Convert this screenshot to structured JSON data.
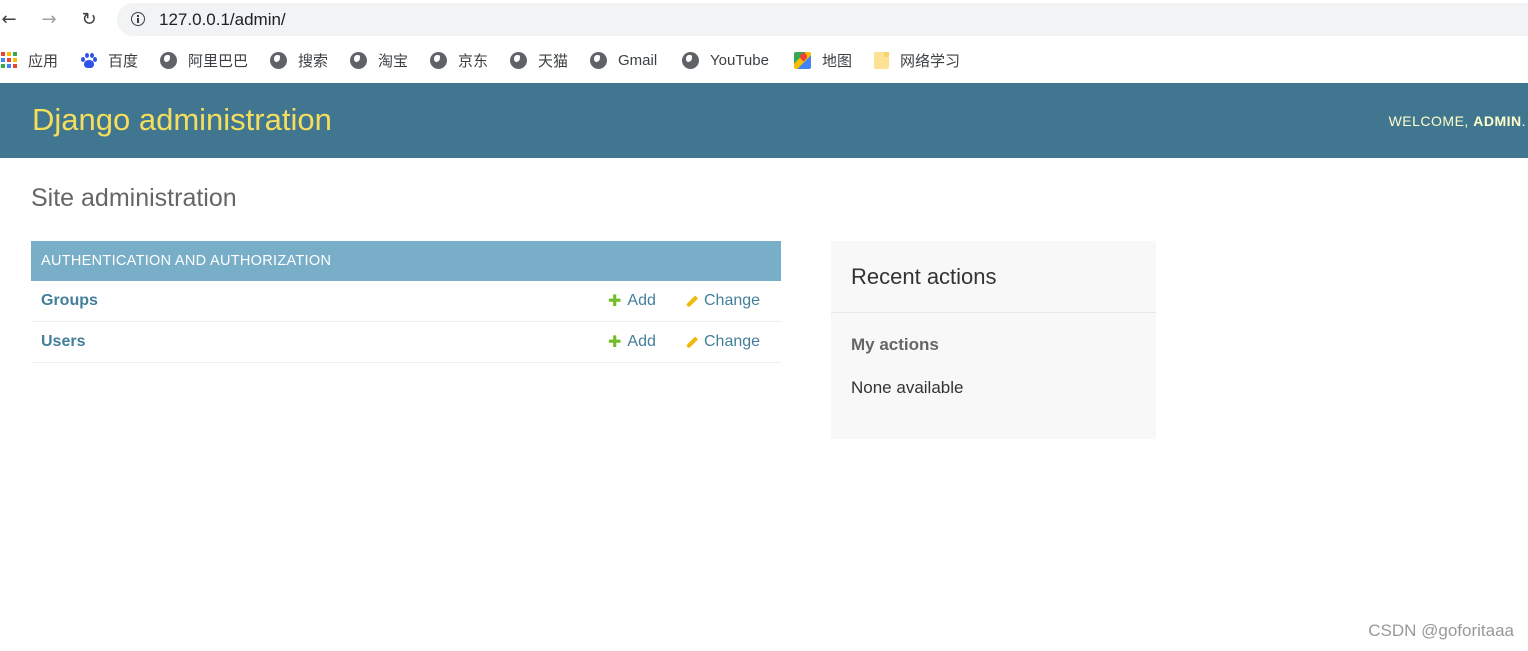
{
  "browser": {
    "nav": {
      "back_glyph": "←",
      "forward_glyph": "→",
      "reload_glyph": "↻"
    },
    "url": "127.0.0.1/admin/",
    "bookmarks": [
      {
        "label": "应用",
        "icon": "apps-grid-icon"
      },
      {
        "label": "百度",
        "icon": "baidu-paw-icon"
      },
      {
        "label": "阿里巴巴",
        "icon": "globe-icon"
      },
      {
        "label": "搜索",
        "icon": "globe-icon"
      },
      {
        "label": "淘宝",
        "icon": "globe-icon"
      },
      {
        "label": "京东",
        "icon": "globe-icon"
      },
      {
        "label": "天猫",
        "icon": "globe-icon"
      },
      {
        "label": "Gmail",
        "icon": "globe-icon"
      },
      {
        "label": "YouTube",
        "icon": "globe-icon"
      },
      {
        "label": "地图",
        "icon": "maps-icon"
      },
      {
        "label": "网络学习",
        "icon": "folder-icon"
      }
    ]
  },
  "header": {
    "branding": "Django administration",
    "welcome_prefix": "WELCOME, ",
    "username": "ADMIN",
    "welcome_suffix": "."
  },
  "main": {
    "title": "Site administration",
    "app_module": {
      "caption": "AUTHENTICATION AND AUTHORIZATION",
      "models": [
        {
          "name": "Groups",
          "add_label": "Add",
          "change_label": "Change"
        },
        {
          "name": "Users",
          "add_label": "Add",
          "change_label": "Change"
        }
      ]
    }
  },
  "sidebar": {
    "title": "Recent actions",
    "subtitle": "My actions",
    "empty_text": "None available"
  },
  "watermark": "CSDN @goforitaaa",
  "colors": {
    "header_bg": "#417690",
    "branding": "#f5dd5d",
    "caption_bg": "#79aec8",
    "link": "#447e9b",
    "add_icon": "#70bf2b",
    "change_icon": "#efb80b"
  }
}
